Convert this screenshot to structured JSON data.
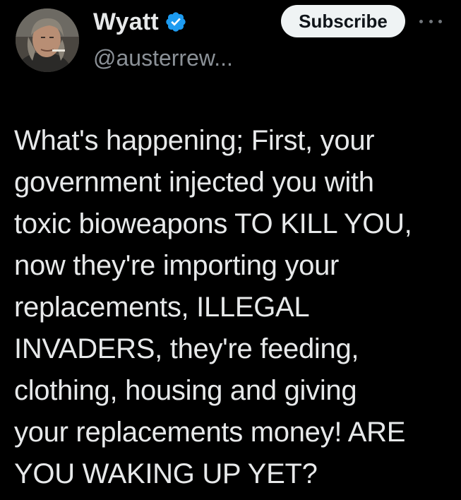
{
  "author": {
    "display_name": "Wyatt",
    "handle": "@austerrew...",
    "verified": true,
    "verified_color": "#1d9bf0"
  },
  "actions": {
    "subscribe_label": "Subscribe",
    "more_icon": "more-horizontal-icon"
  },
  "post": {
    "text": "What's happening; First, your\ngovernment injected you with\ntoxic bioweapons TO KILL YOU,\nnow they're importing your\nreplacements, ILLEGAL\nINVADERS, they're feeding,\nclothing, housing and giving\nyour replacements money! ARE\nYOU WAKING UP YET?"
  },
  "theme": {
    "background": "#000000",
    "text": "#e7e9ea",
    "secondary_text": "#8b9197",
    "button_bg": "#eff3f4"
  }
}
